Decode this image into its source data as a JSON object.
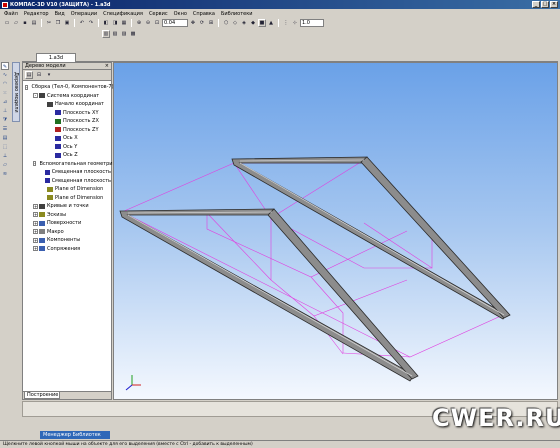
{
  "window": {
    "title": "КОМПАС-3D V10 (ЗАЩИТА) - 1.a3d"
  },
  "menu": [
    "Файл",
    "Редактор",
    "Вид",
    "Операции",
    "Спецификация",
    "Сервис",
    "Окно",
    "Справка",
    "Библиотеки"
  ],
  "toolbar": {
    "scale_value": "0.04",
    "step_value": "1.0"
  },
  "tabs": {
    "document": "1.a3d"
  },
  "left_vtab": "Дерево модели",
  "panel": {
    "title": "Дерево модели",
    "bottom_tab": "Построение",
    "tree": [
      {
        "label": "Сборка (Тел-0, Компонентов-7)",
        "level": 0,
        "expander": "-",
        "icon": "assembly-icon",
        "color": "#3a5fb0"
      },
      {
        "label": "Система координат",
        "level": 1,
        "expander": "-",
        "icon": "coord-system-icon",
        "color": "#404040"
      },
      {
        "label": "Начало координат",
        "level": 2,
        "expander": "",
        "icon": "origin-icon",
        "color": "#404040"
      },
      {
        "label": "Плоскость XY",
        "level": 3,
        "expander": "",
        "icon": "plane-xy-icon",
        "color": "#2a2aa0"
      },
      {
        "label": "Плоскость ZX",
        "level": 3,
        "expander": "",
        "icon": "plane-zx-icon",
        "color": "#207020"
      },
      {
        "label": "Плоскость ZY",
        "level": 3,
        "expander": "",
        "icon": "plane-zy-icon",
        "color": "#b02020"
      },
      {
        "label": "Ось X",
        "level": 3,
        "expander": "",
        "icon": "axis-x-icon",
        "color": "#2a2aa0"
      },
      {
        "label": "Ось Y",
        "level": 3,
        "expander": "",
        "icon": "axis-y-icon",
        "color": "#2a2aa0"
      },
      {
        "label": "Ось Z",
        "level": 3,
        "expander": "",
        "icon": "axis-z-icon",
        "color": "#2a2aa0"
      },
      {
        "label": "Вспомогательная геометри",
        "level": 1,
        "expander": "-",
        "icon": "aux-geometry-icon",
        "color": "#2a4a9a"
      },
      {
        "label": "Смещенная плоскость",
        "level": 2,
        "expander": "",
        "icon": "offset-plane-icon",
        "color": "#2a2aa0"
      },
      {
        "label": "Смещенная плоскость",
        "level": 2,
        "expander": "",
        "icon": "offset-plane-icon",
        "color": "#2a2aa0"
      },
      {
        "label": "Plane of Dimension",
        "level": 2,
        "expander": "",
        "icon": "dimension-plane-icon",
        "color": "#8a8a20"
      },
      {
        "label": "Plane of Dimension",
        "level": 2,
        "expander": "",
        "icon": "dimension-plane-icon",
        "color": "#8a8a20"
      },
      {
        "label": "Кривые и точки",
        "level": 1,
        "expander": "+",
        "icon": "curves-icon",
        "color": "#404040"
      },
      {
        "label": "Эскизы",
        "level": 1,
        "expander": "+",
        "icon": "sketch-icon",
        "color": "#8a8a20"
      },
      {
        "label": "Поверхности",
        "level": 1,
        "expander": "+",
        "icon": "surface-icon",
        "color": "#3a5fb0"
      },
      {
        "label": "Макро",
        "level": 1,
        "expander": "+",
        "icon": "macro-icon",
        "color": "#808080"
      },
      {
        "label": "Компоненты",
        "level": 1,
        "expander": "+",
        "icon": "components-icon",
        "color": "#3a5fb0"
      },
      {
        "label": "Сопряжения",
        "level": 1,
        "expander": "+",
        "icon": "mates-icon",
        "color": "#3a5fb0"
      }
    ]
  },
  "taskbar": {
    "manager": "Менеджер Библиотек"
  },
  "status": "Щелкните левой кнопкой мыши на объекте для его выделения (вместе с Ctrl - добавить к выделенным)",
  "watermark": "CWER.RU",
  "colors": {
    "construction_lines": "#e040e0",
    "truss_fill": "#8c8c8c",
    "truss_edge": "#2a2a2a",
    "titlebar": "#0a246a"
  }
}
